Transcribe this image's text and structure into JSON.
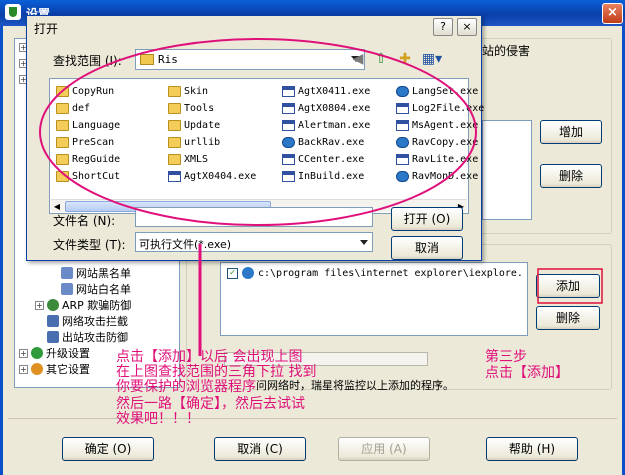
{
  "outer": {
    "title": "设置",
    "close_label": "×",
    "header_partial": "站的侵害",
    "add_button": "增加",
    "delete_button": "删除",
    "list_entry": "c:\\program files\\internet explorer\\iexplore.",
    "add_button2": "添加",
    "delete_button2": "删除",
    "note_text": "问网络时，瑞星将监控以上添加的程序。",
    "ok_button": "确定 (O)",
    "cancel_button": "取消 (C)",
    "apply_button": "应用 (A)",
    "help_button": "帮助 (H)"
  },
  "tree": {
    "items": [
      {
        "label": "网站黑名单"
      },
      {
        "label": "网站白名单"
      },
      {
        "label": "ARP 欺骗防御"
      },
      {
        "label": "网络攻击拦截"
      },
      {
        "label": "出站攻击防御"
      },
      {
        "label": "升级设置"
      },
      {
        "label": "其它设置"
      }
    ]
  },
  "dialog": {
    "title": "打开",
    "help_btn": "?",
    "close_btn": "×",
    "look_in_label": "查找范围 (I):",
    "look_in_value": "Ris",
    "filename_label": "文件名 (N):",
    "filename_value": "",
    "filetype_label": "文件类型 (T):",
    "filetype_value": "可执行文件(*.exe)",
    "open_button": "打开 (O)",
    "cancel_button": "取消",
    "files_col1": [
      {
        "name": "CopyRun",
        "icon": "folder-icon"
      },
      {
        "name": "def",
        "icon": "folder-icon"
      },
      {
        "name": "Language",
        "icon": "folder-icon"
      },
      {
        "name": "PreScan",
        "icon": "folder-icon"
      },
      {
        "name": "RegGuide",
        "icon": "folder-icon"
      },
      {
        "name": "ShortCut",
        "icon": "folder-icon"
      }
    ],
    "files_col2": [
      {
        "name": "Skin",
        "icon": "folder-icon"
      },
      {
        "name": "Tools",
        "icon": "folder-icon"
      },
      {
        "name": "Update",
        "icon": "folder-icon"
      },
      {
        "name": "urllib",
        "icon": "folder-icon"
      },
      {
        "name": "XMLS",
        "icon": "folder-icon"
      },
      {
        "name": "AgtX0404.exe",
        "icon": "exe-icon"
      }
    ],
    "files_col3": [
      {
        "name": "AgtX0411.exe",
        "icon": "exe-icon"
      },
      {
        "name": "AgtX0804.exe",
        "icon": "exe-icon"
      },
      {
        "name": "Alertman.exe",
        "icon": "exe-icon"
      },
      {
        "name": "BackRav.exe",
        "icon": "app-icon"
      },
      {
        "name": "CCenter.exe",
        "icon": "exe-icon"
      },
      {
        "name": "InBuild.exe",
        "icon": "exe-icon"
      }
    ],
    "files_col4": [
      {
        "name": "LangSet.exe",
        "icon": "app-icon"
      },
      {
        "name": "Log2File.exe",
        "icon": "exe-icon"
      },
      {
        "name": "MsAgent.exe",
        "icon": "exe-icon"
      },
      {
        "name": "RavCopy.exe",
        "icon": "app-icon"
      },
      {
        "name": "RavLite.exe",
        "icon": "exe-icon"
      },
      {
        "name": "RavMonD.exe",
        "icon": "app-icon"
      }
    ]
  },
  "annotations": {
    "left_lines": [
      "点击【添加】以后 会出现上图",
      "在上图查找范围的三角下拉 找到",
      "你要保护的浏览器程序",
      "然后一路【确定】，然后去试试",
      "效果吧！！！"
    ],
    "right_lines": [
      "第三步",
      "点击【添加】"
    ],
    "color": "#e0107a"
  }
}
